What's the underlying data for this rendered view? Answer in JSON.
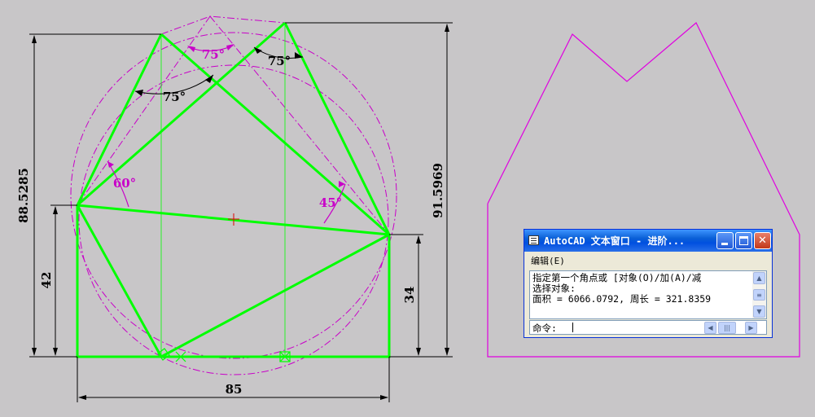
{
  "drawing": {
    "dimensions": {
      "total_width": "85",
      "left_height": "88.5285",
      "left_low_height": "42",
      "right_height": "91.5969",
      "right_low_height": "34"
    },
    "angles": {
      "top_middle": "75°",
      "top_right": "75°",
      "upper_left": "75°",
      "left_mid": "60°",
      "right_mid": "45°"
    },
    "colors": {
      "background": "#c8c6c8",
      "geometry": "#00ff00",
      "construction": "#c800c8",
      "dimension": "#000000"
    }
  },
  "text_window": {
    "title": "AutoCAD 文本窗口 - 进阶...",
    "menu": "编辑(E)",
    "lines": [
      "指定第一个角点或 [对象(O)/加(A)/减",
      "选择对象:",
      "面积 = 6066.0792, 周长 = 321.8359"
    ],
    "command_label": "命令:",
    "buttons": {
      "minimize": "minimize-icon",
      "maximize": "maximize-icon",
      "close": "close-icon"
    }
  }
}
